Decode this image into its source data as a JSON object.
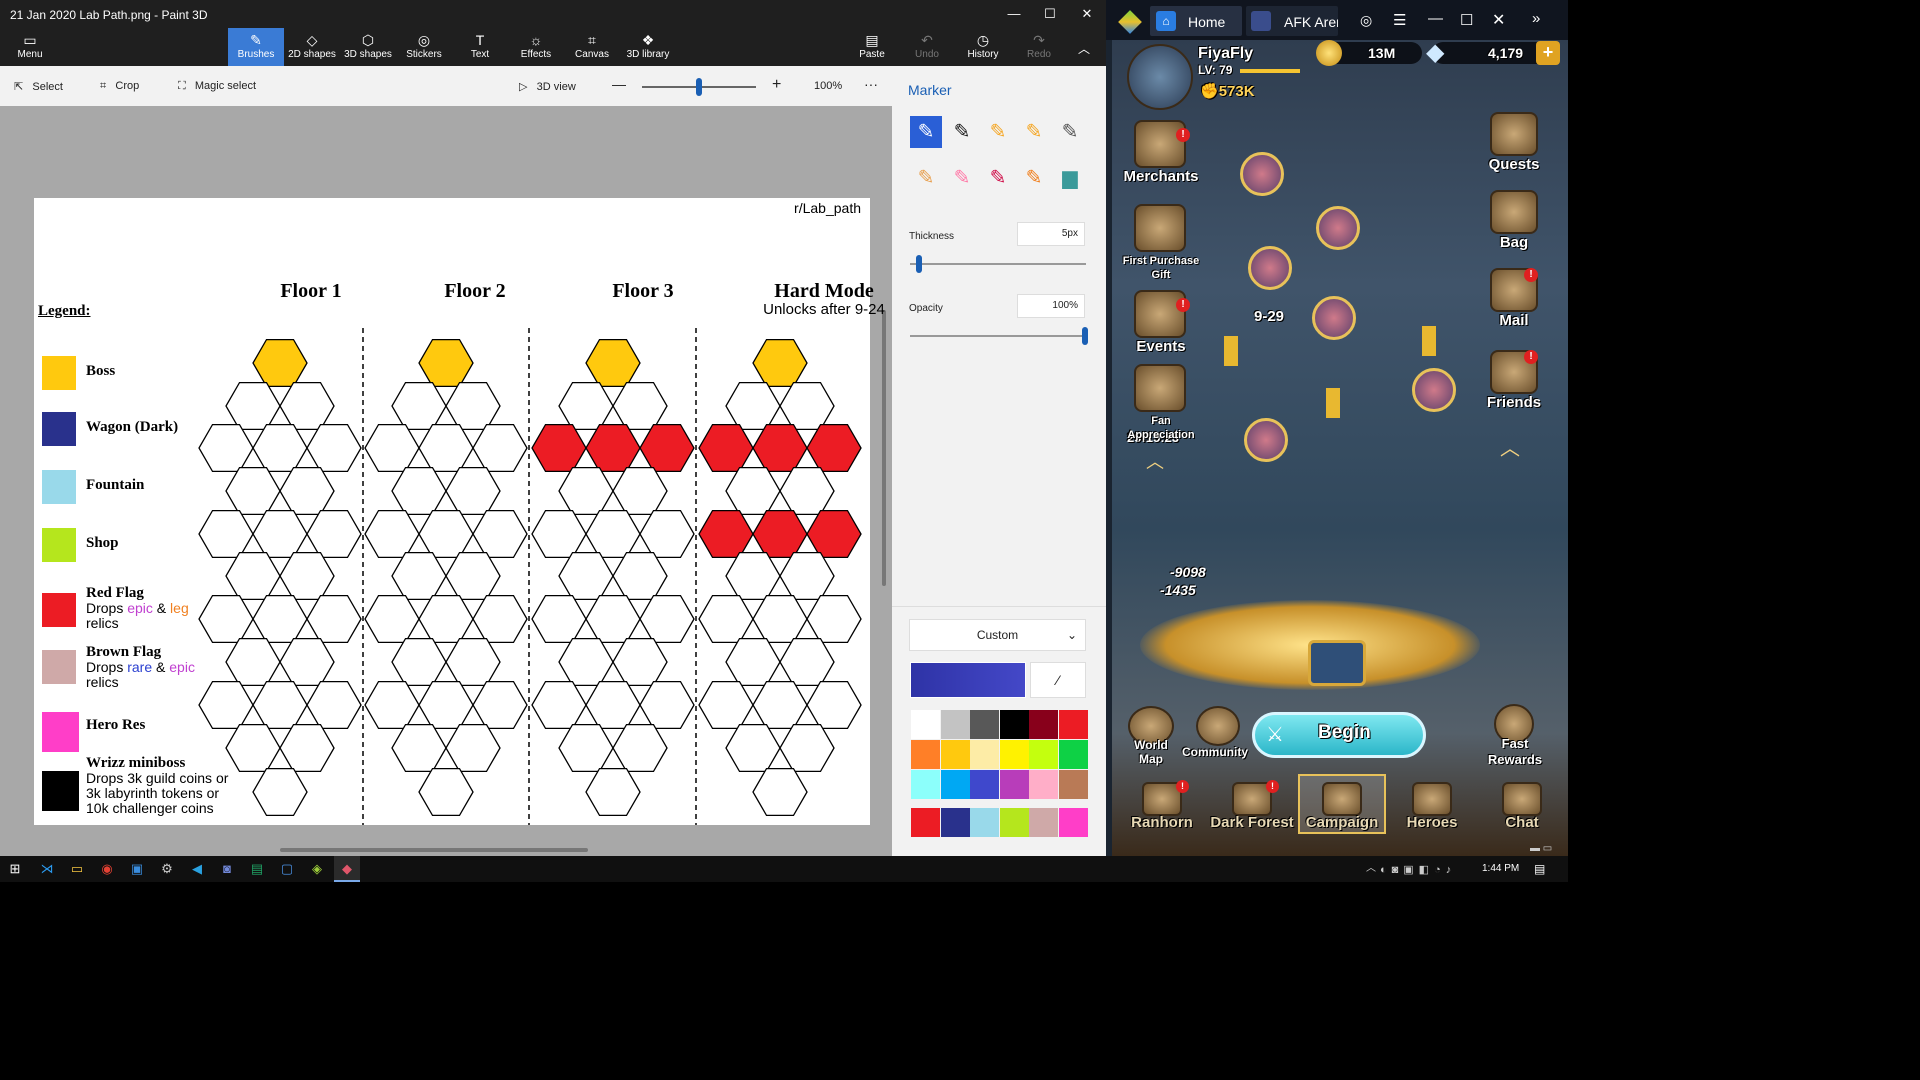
{
  "paint": {
    "title": "21 Jan 2020 Lab Path.png - Paint 3D",
    "menu_label": "Menu",
    "tools": [
      {
        "label": "Brushes",
        "icon": "brush-icon"
      },
      {
        "label": "2D shapes",
        "icon": "shapes-2d-icon"
      },
      {
        "label": "3D shapes",
        "icon": "cube-icon"
      },
      {
        "label": "Stickers",
        "icon": "sticker-icon"
      },
      {
        "label": "Text",
        "icon": "text-icon"
      },
      {
        "label": "Effects",
        "icon": "effects-icon"
      },
      {
        "label": "Canvas",
        "icon": "canvas-icon"
      },
      {
        "label": "3D library",
        "icon": "library-icon"
      }
    ],
    "right_tools": [
      {
        "label": "Paste",
        "icon": "paste-icon"
      },
      {
        "label": "Undo",
        "icon": "undo-icon"
      },
      {
        "label": "History",
        "icon": "history-icon"
      },
      {
        "label": "Redo",
        "icon": "redo-icon"
      }
    ],
    "select_label": "Select",
    "crop_label": "Crop",
    "magic_label": "Magic select",
    "view3d_label": "3D view",
    "zoom_level": "100%",
    "zoom_value": 0.5,
    "side": {
      "title": "Marker",
      "thickness_label": "Thickness",
      "thickness_value": "5px",
      "thickness_level": 0.05,
      "opacity_label": "Opacity",
      "opacity_value": "100%",
      "opacity_level": 1.0,
      "color_mode": "Custom",
      "current_color": "#2e33a6",
      "palette": [
        "#ffffff",
        "#c3c3c3",
        "#585858",
        "#000000",
        "#88001b",
        "#ec1c24",
        "#ff7f27",
        "#ffc90e",
        "#fdeca6",
        "#fff200",
        "#c4ff0e",
        "#0ed145",
        "#8cfffb",
        "#00a8f3",
        "#3f48cc",
        "#b83dba",
        "#ffaec8",
        "#b97a56"
      ],
      "recent": [
        "#ec1c24",
        "#29318c",
        "#99d9ea",
        "#b5e61d",
        "#cfa9a8",
        "#ff3ec8"
      ]
    },
    "sheet": {
      "credit": "r/Lab_path",
      "legend_title": "Legend:",
      "floors": [
        {
          "title": "Floor 1",
          "sub": ""
        },
        {
          "title": "Floor 2",
          "sub": ""
        },
        {
          "title": "Floor 3",
          "sub": ""
        },
        {
          "title": "Hard Mode",
          "sub": "Unlocks after 9-24"
        }
      ],
      "legend": [
        {
          "name": "Boss",
          "color": "#ffc90e"
        },
        {
          "name": "Wagon (Dark)",
          "color": "#29318c"
        },
        {
          "name": "Fountain",
          "color": "#99d9ea"
        },
        {
          "name": "Shop",
          "color": "#b5e61d"
        },
        {
          "name": "Red Flag",
          "color": "#ec1c24",
          "desc": [
            "Drops ",
            "epic",
            " & ",
            "leg"
          ],
          "desc2": "relics"
        },
        {
          "name": "Brown Flag",
          "color": "#cfa9a8",
          "desc": [
            "Drops ",
            "rare",
            " & ",
            "epic"
          ],
          "desc2": "relics"
        },
        {
          "name": "Hero Res",
          "color": "#ff3ec8"
        },
        {
          "name": "Wrizz miniboss",
          "color": "#000000",
          "lines": [
            "Drops 3k guild coins or",
            "3k labyrinth tokens or",
            "10k challenger coins"
          ]
        }
      ],
      "red_rows": {
        "floor3": [
          2
        ],
        "hard": [
          2,
          4
        ]
      }
    }
  },
  "emulator": {
    "tabs": [
      "Home",
      "AFK Arer"
    ],
    "player": {
      "name": "FiyaFly",
      "level": "LV: 79",
      "power": "573K",
      "gold": "13M",
      "gems": "4,179"
    },
    "left_menu": [
      "Merchants",
      "First Purchase Gift",
      "Events",
      "Fan Appreciation"
    ],
    "timer": "29:15:23",
    "right_menu": [
      "Quests",
      "Bag",
      "Mail",
      "Friends"
    ],
    "stage": "9-29",
    "damage": [
      "-9098",
      "-1435"
    ],
    "begin_label": "Begin",
    "world_map": "World Map",
    "community": "Community",
    "fast_rewards": "Fast Rewards",
    "nav": [
      "Ranhorn",
      "Dark Forest",
      "Campaign",
      "Heroes",
      "Chat"
    ]
  },
  "taskbar": {
    "time": "1:44 PM"
  }
}
